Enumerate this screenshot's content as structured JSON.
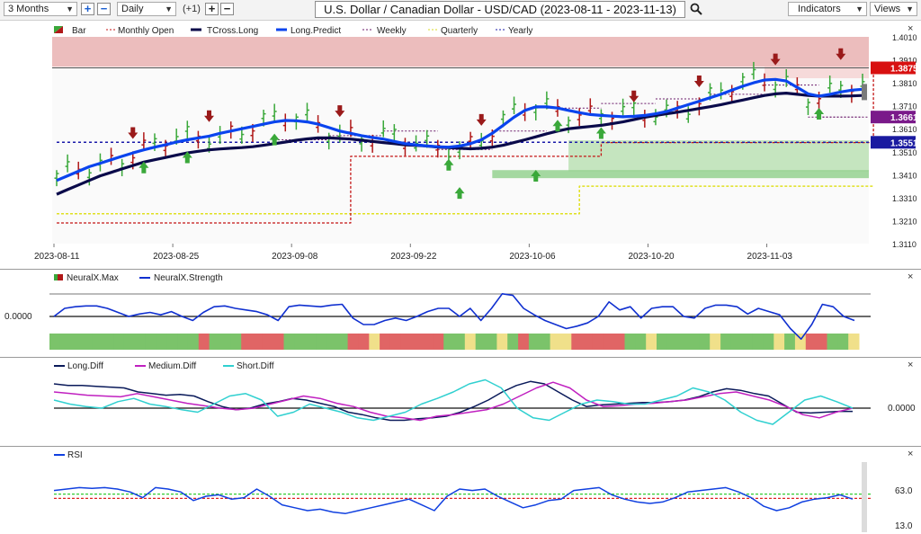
{
  "toolbar": {
    "period": "3 Months",
    "add_label": "+",
    "remove_label": "−",
    "interval": "Daily",
    "offset": "(+1)",
    "title": "U.S. Dollar / Canadian Dollar - USD/CAD (2023-08-11 - 2023-11-13)",
    "indicators_label": "Indicators",
    "views_label": "Views"
  },
  "legend": {
    "items": [
      "Bar",
      "Monthly Open",
      "TCross.Long",
      "Long.Predict",
      "Weekly",
      "Quarterly",
      "Yearly"
    ]
  },
  "colors": {
    "up": "#3aa83a",
    "down": "#b01818",
    "tcross": "#0a0a4a",
    "predict": "#0a44ee",
    "monthly": "#c41414",
    "weekly": "#6a1a6a",
    "quarterly": "#e8e82a",
    "yearly": "#1a1aaa",
    "neural": "#1030d0",
    "long_diff": "#0a1a5a",
    "medium_diff": "#c020c0",
    "short_diff": "#30d0d0",
    "rsi": "#1040e0"
  },
  "chart_data": [
    {
      "type": "line",
      "title": "U.S. Dollar / Canadian Dollar - USD/CAD (2023-08-11 - 2023-11-13)",
      "x_dates": [
        "2023-08-11",
        "2023-08-25",
        "2023-09-08",
        "2023-09-22",
        "2023-10-06",
        "2023-10-20",
        "2023-11-03"
      ],
      "ylim": [
        1.311,
        1.401
      ],
      "yticks": [
        "1.4010",
        "1.3910",
        "1.3810",
        "1.3710",
        "1.3610",
        "1.3510",
        "1.3410",
        "1.3310",
        "1.3210",
        "1.3110"
      ],
      "price_labels": [
        {
          "value": 1.3875,
          "text": "1.3875",
          "color": "#d81010"
        },
        {
          "value": 1.3661,
          "text": "1.3661",
          "color": "#7a1a8a"
        },
        {
          "value": 1.3551,
          "text": "1.3551",
          "color": "#1a1aa0"
        }
      ],
      "series": [
        {
          "name": "TCross.Long",
          "values": [
            1.3325,
            1.3345,
            1.3365,
            1.3385,
            1.3405,
            1.342,
            1.3435,
            1.345,
            1.3465,
            1.3475,
            1.3485,
            1.3495,
            1.3505,
            1.3512,
            1.3518,
            1.3522,
            1.3525,
            1.3528,
            1.3532,
            1.3538,
            1.3545,
            1.3552,
            1.356,
            1.3566,
            1.357,
            1.357,
            1.3568,
            1.3565,
            1.356,
            1.3555,
            1.355,
            1.3545,
            1.354,
            1.3538,
            1.3535,
            1.353,
            1.3528,
            1.3525,
            1.3523,
            1.3525,
            1.353,
            1.3538,
            1.355,
            1.3562,
            1.3575,
            1.3588,
            1.36,
            1.361,
            1.3615,
            1.362,
            1.3625,
            1.3632,
            1.364,
            1.365,
            1.366,
            1.3668,
            1.3675,
            1.3682,
            1.369,
            1.3698,
            1.3706,
            1.3715,
            1.3725,
            1.3735,
            1.3745,
            1.3755,
            1.3762,
            1.3765,
            1.376,
            1.3755,
            1.3752,
            1.3752,
            1.3752,
            1.3753,
            1.3755
          ]
        },
        {
          "name": "Long.Predict",
          "values": [
            1.3385,
            1.3405,
            1.3425,
            1.3445,
            1.346,
            1.3475,
            1.349,
            1.3505,
            1.3518,
            1.353,
            1.354,
            1.3552,
            1.3562,
            1.357,
            1.3578,
            1.359,
            1.36,
            1.361,
            1.362,
            1.363,
            1.364,
            1.3646,
            1.3645,
            1.364,
            1.363,
            1.3615,
            1.36,
            1.359,
            1.358,
            1.3572,
            1.3565,
            1.3555,
            1.3545,
            1.354,
            1.3535,
            1.3532,
            1.353,
            1.3535,
            1.3545,
            1.3562,
            1.359,
            1.3625,
            1.366,
            1.369,
            1.3705,
            1.3705,
            1.37,
            1.369,
            1.368,
            1.3672,
            1.3668,
            1.3665,
            1.3662,
            1.3664,
            1.3668,
            1.3675,
            1.3685,
            1.37,
            1.3715,
            1.373,
            1.3745,
            1.376,
            1.3778,
            1.3795,
            1.381,
            1.3822,
            1.3825,
            1.3818,
            1.379,
            1.3762,
            1.3752,
            1.376,
            1.377,
            1.3778,
            1.3782
          ]
        },
        {
          "name": "Monthly Open",
          "values": [
            [
              0,
              1.32
            ],
            [
              21,
              1.32
            ],
            [
              27,
              1.349
            ],
            [
              46,
              1.349
            ],
            [
              50,
              1.355
            ],
            [
              75,
              1.388
            ]
          ]
        },
        {
          "name": "Quarterly",
          "values": [
            [
              0,
              1.324
            ],
            [
              48,
              1.324
            ],
            [
              48,
              1.336
            ],
            [
              75,
              1.336
            ]
          ]
        },
        {
          "name": "Yearly",
          "values": [
            [
              0,
              1.3551
            ],
            [
              75,
              1.3551
            ]
          ]
        }
      ]
    },
    {
      "type": "line",
      "series": [
        {
          "name": "NeuralX.Max",
          "values": [
            1,
            1,
            1,
            1,
            1,
            1,
            1,
            1,
            1,
            1,
            1,
            1,
            1,
            1,
            0,
            1,
            1,
            1,
            0,
            0,
            0,
            0,
            1,
            1,
            1,
            1,
            1,
            1,
            0,
            0,
            2,
            0,
            0,
            0,
            0,
            0,
            0,
            1,
            1,
            2,
            1,
            1,
            2,
            1,
            0,
            1,
            1,
            2,
            2,
            0,
            0,
            0,
            0,
            0,
            1,
            1,
            2,
            1,
            1,
            1,
            1,
            1,
            2,
            1,
            1,
            1,
            1,
            1,
            2,
            1,
            2,
            0,
            0,
            1,
            1,
            2
          ]
        },
        {
          "name": "NeuralX.Strength",
          "values": [
            0.0,
            0.1,
            0.12,
            0.13,
            0.13,
            0.1,
            0.05,
            0.0,
            0.03,
            0.05,
            0.02,
            0.06,
            0.0,
            -0.05,
            0.05,
            0.12,
            0.13,
            0.1,
            0.08,
            0.06,
            0.02,
            -0.05,
            0.12,
            0.14,
            0.13,
            0.12,
            0.14,
            0.15,
            -0.02,
            -0.1,
            -0.1,
            -0.05,
            -0.02,
            -0.05,
            0.0,
            0.06,
            0.1,
            0.1,
            0.0,
            0.1,
            -0.05,
            0.1,
            0.28,
            0.26,
            0.1,
            0.02,
            -0.05,
            -0.1,
            -0.15,
            -0.12,
            -0.08,
            0.0,
            0.18,
            0.08,
            0.12,
            -0.02,
            0.1,
            0.12,
            0.12,
            0.0,
            -0.02,
            0.1,
            0.14,
            0.14,
            0.12,
            0.03,
            0.1,
            0.06,
            0.02,
            -0.15,
            -0.28,
            -0.1,
            0.15,
            0.12,
            0.0,
            -0.05
          ]
        }
      ],
      "zero_label": "0.0000"
    },
    {
      "type": "line",
      "series": [
        {
          "name": "Long.Diff",
          "values": [
            0.3,
            0.28,
            0.28,
            0.27,
            0.26,
            0.25,
            0.2,
            0.18,
            0.16,
            0.17,
            0.15,
            0.08,
            0.02,
            -0.02,
            0.0,
            0.05,
            0.08,
            0.12,
            0.1,
            0.06,
            0.02,
            -0.05,
            -0.08,
            -0.12,
            -0.15,
            -0.15,
            -0.13,
            -0.12,
            -0.1,
            -0.05,
            0.02,
            0.1,
            0.2,
            0.28,
            0.33,
            0.3,
            0.2,
            0.1,
            0.02,
            0.04,
            0.05,
            0.06,
            0.07,
            0.07,
            0.08,
            0.1,
            0.14,
            0.2,
            0.24,
            0.22,
            0.18,
            0.15,
            0.05,
            -0.05,
            -0.06,
            -0.05,
            -0.04,
            -0.04
          ]
        },
        {
          "name": "Medium.Diff",
          "values": [
            0.2,
            0.18,
            0.16,
            0.15,
            0.14,
            0.18,
            0.14,
            0.1,
            0.06,
            0.03,
            0.0,
            -0.02,
            0.0,
            0.05,
            0.1,
            0.15,
            0.12,
            0.06,
            0.02,
            -0.05,
            -0.1,
            -0.12,
            -0.15,
            -0.1,
            -0.08,
            -0.05,
            -0.02,
            0.05,
            0.15,
            0.25,
            0.32,
            0.25,
            0.1,
            0.02,
            0.03,
            0.05,
            0.06,
            0.08,
            0.1,
            0.14,
            0.18,
            0.2,
            0.15,
            0.1,
            0.02,
            -0.08,
            -0.12,
            -0.05,
            0.0
          ]
        },
        {
          "name": "Short.Diff",
          "values": [
            0.1,
            0.05,
            0.02,
            0.0,
            0.08,
            0.12,
            0.05,
            0.02,
            -0.02,
            -0.05,
            0.05,
            0.15,
            0.18,
            0.1,
            -0.1,
            -0.05,
            0.05,
            0.0,
            -0.05,
            -0.12,
            -0.15,
            -0.1,
            -0.05,
            0.05,
            0.12,
            0.2,
            0.3,
            0.35,
            0.25,
            0.0,
            -0.12,
            -0.15,
            -0.05,
            0.05,
            0.1,
            0.08,
            0.05,
            0.05,
            0.1,
            0.15,
            0.25,
            0.2,
            0.1,
            -0.05,
            -0.15,
            -0.2,
            -0.05,
            0.1,
            0.15,
            0.08,
            0.0
          ]
        }
      ],
      "zero_label": "0.0000"
    },
    {
      "type": "line",
      "series": [
        {
          "name": "RSI",
          "values": [
            68,
            70,
            72,
            71,
            72,
            70,
            66,
            58,
            72,
            70,
            66,
            54,
            60,
            62,
            56,
            58,
            70,
            60,
            48,
            44,
            40,
            42,
            38,
            36,
            40,
            44,
            48,
            52,
            56,
            48,
            40,
            60,
            70,
            68,
            70,
            60,
            52,
            44,
            48,
            54,
            56,
            68,
            70,
            72,
            62,
            56,
            52,
            50,
            52,
            58,
            66,
            68,
            70,
            72,
            66,
            58,
            46,
            40,
            44,
            52,
            56,
            58,
            62,
            56
          ]
        }
      ],
      "labels": [
        "63.0",
        "13.0"
      ],
      "levels": [
        63,
        57
      ]
    }
  ],
  "panels": {
    "neural": {
      "legend": [
        "NeuralX.Max",
        "NeuralX.Strength"
      ],
      "label": "0.0000"
    },
    "diff": {
      "legend": [
        "Long.Diff",
        "Medium.Diff",
        "Short.Diff"
      ],
      "label": "0.0000"
    },
    "rsi": {
      "legend": [
        "RSI"
      ],
      "label_top": "63.0",
      "label_bottom": "13.0"
    }
  }
}
